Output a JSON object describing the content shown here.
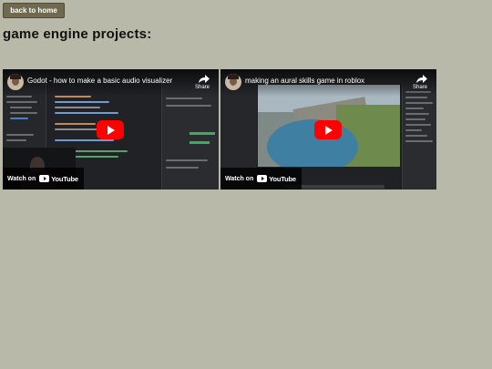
{
  "nav": {
    "back_label": "back to home"
  },
  "page": {
    "heading": "game engine projects:"
  },
  "videos": [
    {
      "title": "Godot - how to make a basic audio visualizer",
      "share_label": "Share",
      "watch_label": "Watch on",
      "youtube_label": "YouTube"
    },
    {
      "title": "making an aural skills game in roblox",
      "share_label": "Share",
      "watch_label": "Watch on",
      "youtube_label": "YouTube"
    }
  ],
  "colors": {
    "page_background": "#b9b9a9",
    "button_background": "#6f6a4f",
    "play_button": "#ff0000"
  }
}
